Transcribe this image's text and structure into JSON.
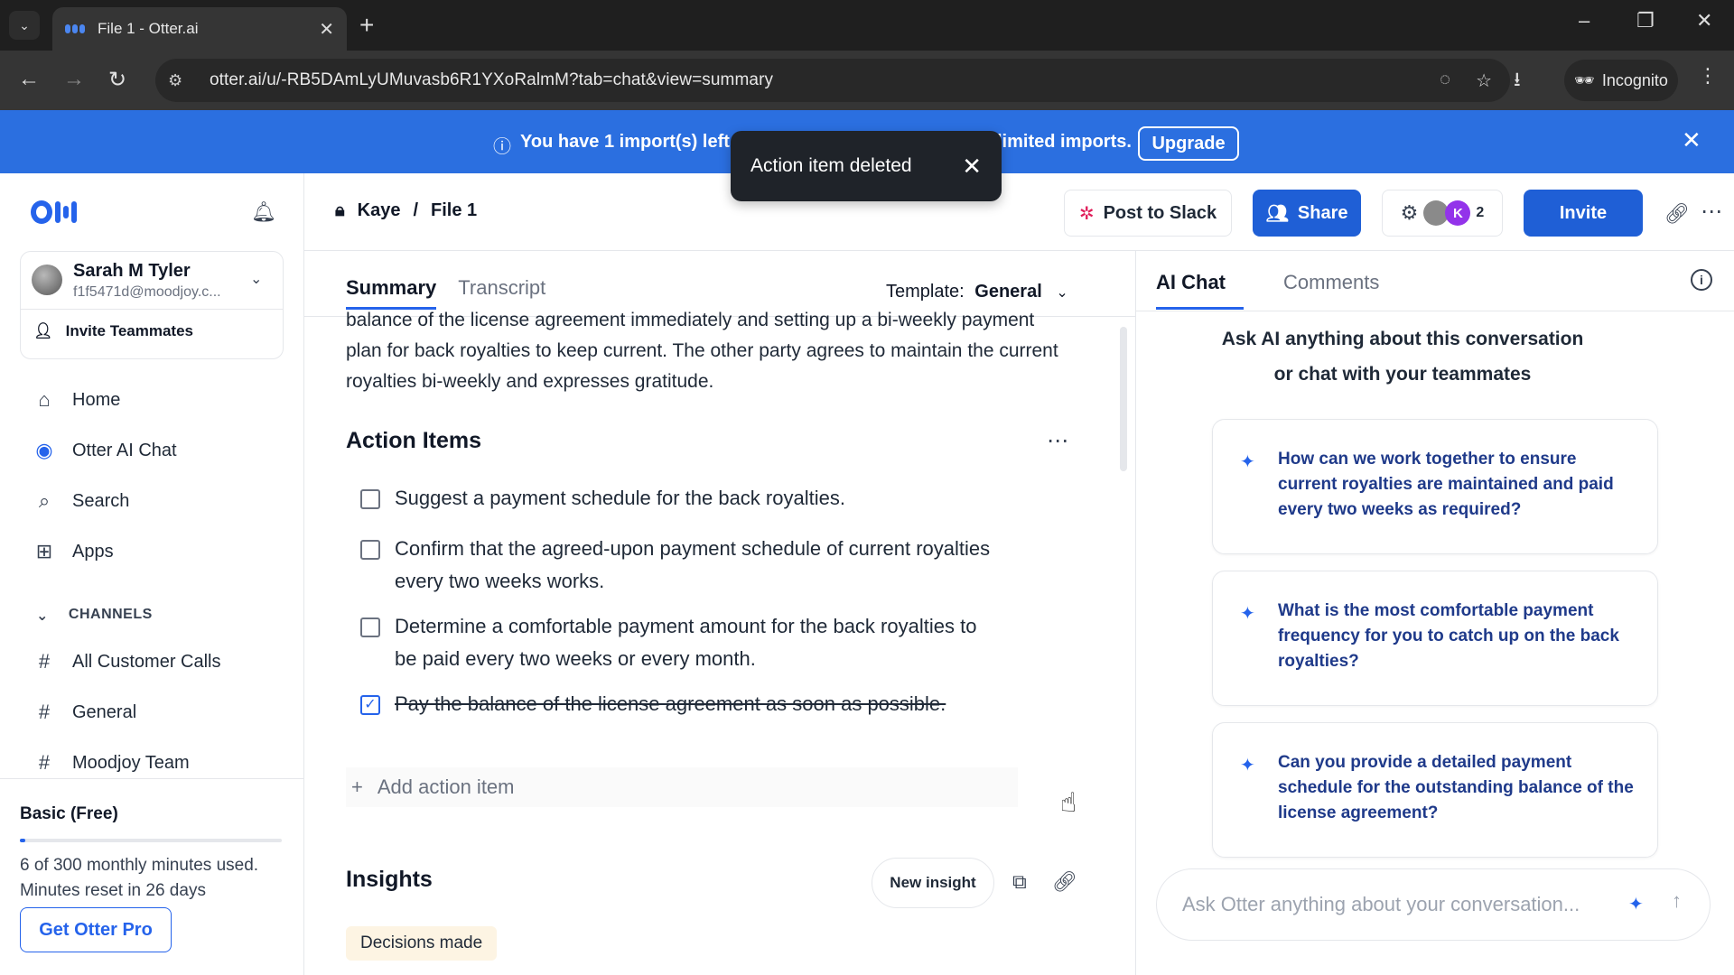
{
  "browser": {
    "tab_title": "File 1 - Otter.ai",
    "url": "otter.ai/u/-RB5DAmLyUMuvasb6R1YXoRalmM?tab=chat&view=summary",
    "incognito_label": "Incognito"
  },
  "banner": {
    "text_left": "You have 1 import(s) left. U",
    "text_right": "limited imports.",
    "upgrade_label": "Upgrade"
  },
  "toast": {
    "message": "Action item deleted"
  },
  "sidebar": {
    "user_name": "Sarah M Tyler",
    "user_email": "f1f5471d@moodjoy.c...",
    "invite_teammates": "Invite Teammates",
    "nav": [
      {
        "label": "Home"
      },
      {
        "label": "Otter AI Chat"
      },
      {
        "label": "Search"
      },
      {
        "label": "Apps"
      }
    ],
    "channels_heading": "CHANNELS",
    "channels": [
      {
        "label": "All Customer Calls"
      },
      {
        "label": "General"
      },
      {
        "label": "Moodjoy Team"
      }
    ],
    "plan_name": "Basic (Free)",
    "usage_fraction": 0.02,
    "usage_line1": "6 of 300 monthly minutes used.",
    "usage_line2": "Minutes reset in 26 days",
    "get_pro": "Get Otter Pro"
  },
  "header": {
    "breadcrumb_owner": "Kaye",
    "breadcrumb_sep": "/",
    "breadcrumb_file": "File 1",
    "post_to_slack": "Post to Slack",
    "share": "Share",
    "participant_initial": "K",
    "participant_count": "2",
    "invite": "Invite"
  },
  "summary": {
    "tab_summary": "Summary",
    "tab_transcript": "Transcript",
    "template_label": "Template:",
    "template_value": "General",
    "text": "balance of the license agreement immediately and setting up a bi-weekly payment plan for back royalties to keep current. The other party agrees to maintain the current royalties bi-weekly and expresses gratitude.",
    "action_items_heading": "Action Items",
    "action_items": [
      {
        "text": "Suggest a payment schedule for the back royalties.",
        "done": false
      },
      {
        "text": "Confirm that the agreed-upon payment schedule of current royalties every two weeks works.",
        "done": false
      },
      {
        "text": "Determine a comfortable payment amount for the back royalties to be paid every two weeks or every month.",
        "done": false
      },
      {
        "text": "Pay the balance of the license agreement as soon as possible.",
        "done": true
      }
    ],
    "add_action_item": "Add action item",
    "insights_heading": "Insights",
    "new_insight": "New insight",
    "decisions_tag": "Decisions made"
  },
  "chat": {
    "tab_ai_chat": "AI Chat",
    "tab_comments": "Comments",
    "intro_line1": "Ask AI anything about this conversation",
    "intro_line2": "or chat with your teammates",
    "suggestions": [
      {
        "text": "How can we work together to ensure current royalties are maintained and paid every two weeks as required?"
      },
      {
        "text": "What is the most comfortable payment frequency for you to catch up on the back royalties?"
      },
      {
        "text": "Can you provide a detailed payment schedule for the outstanding balance of the license agreement?"
      }
    ],
    "input_placeholder": "Ask Otter anything about your conversation..."
  },
  "colors": {
    "brand_blue": "#2563eb",
    "banner_blue": "#2b6fe0",
    "button_blue": "#1f5fd6",
    "toast_bg": "#1f2329"
  }
}
